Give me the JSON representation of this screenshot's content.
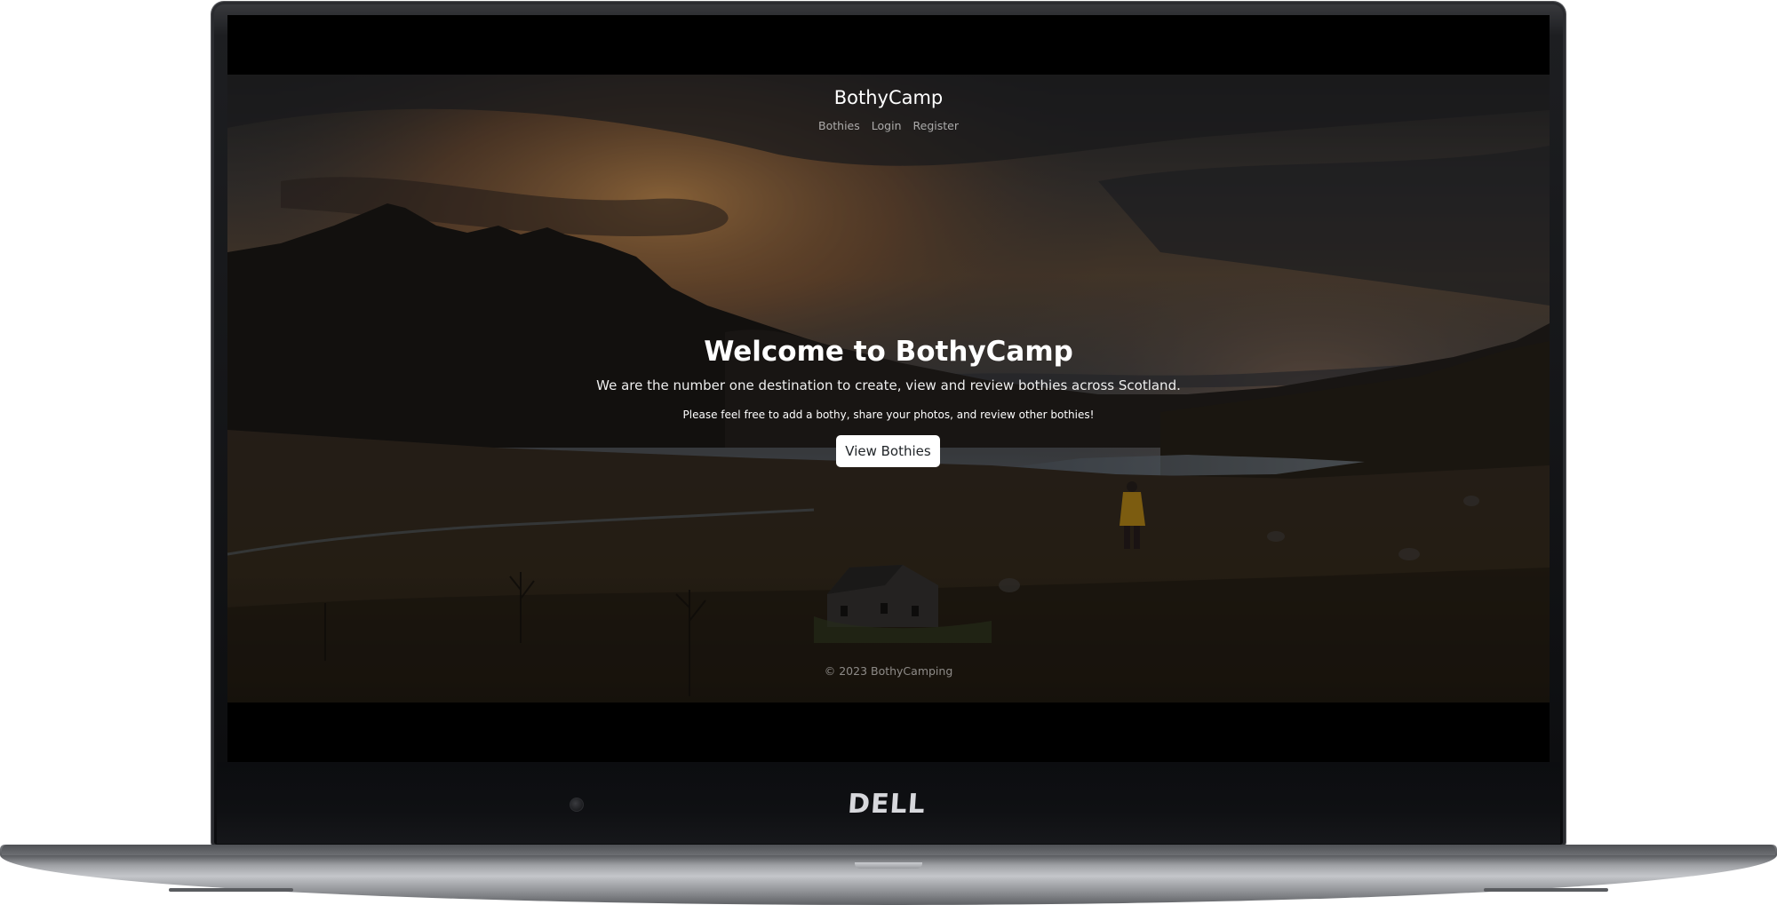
{
  "device": {
    "brand_logo": "DELL"
  },
  "site": {
    "brand": "BothyCamp",
    "nav": [
      {
        "label": "Bothies"
      },
      {
        "label": "Login"
      },
      {
        "label": "Register"
      }
    ],
    "hero": {
      "title": "Welcome to BothyCamp",
      "lead": "We are the number one destination to create, view and review bothies across Scotland.",
      "sub": "Please feel free to add a bothy, share your photos, and review other bothies!",
      "button_label": "View Bothies"
    },
    "footer": "© 2023 BothyCamping"
  },
  "colors": {
    "overlay": "#000000",
    "button_bg": "#ffffff",
    "button_text": "#212529",
    "hiker_jacket": "#d9a21f"
  }
}
